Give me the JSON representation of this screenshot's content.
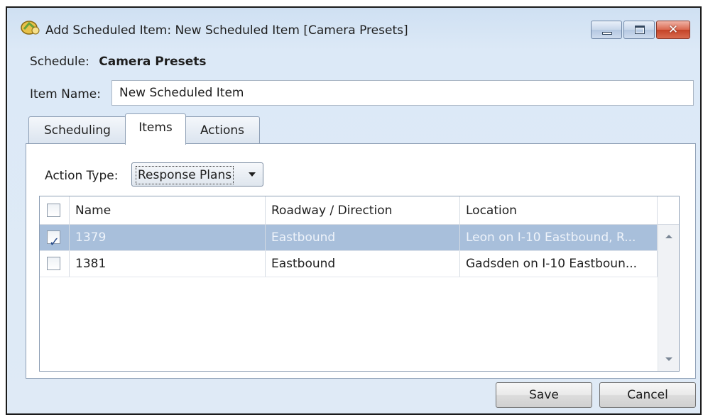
{
  "window": {
    "title": "Add Scheduled Item: New Scheduled Item [Camera Presets]",
    "icon": "scheduled-item-app-icon",
    "controls": {
      "minimize": "minimize-icon",
      "maximize": "maximize-icon",
      "close_glyph": "✕"
    }
  },
  "schedule": {
    "label": "Schedule:",
    "value": "Camera Presets"
  },
  "item_name": {
    "label": "Item Name:",
    "value": "New Scheduled Item"
  },
  "tabs": [
    {
      "label": "Scheduling",
      "active": false
    },
    {
      "label": "Items",
      "active": true
    },
    {
      "label": "Actions",
      "active": false
    }
  ],
  "action_type": {
    "label": "Action Type:",
    "selected": "Response Plans"
  },
  "grid": {
    "columns": [
      "Name",
      "Roadway / Direction",
      "Location"
    ],
    "rows": [
      {
        "checked": true,
        "selected": true,
        "name": "1379",
        "roadway": "Eastbound",
        "location": "Leon on I-10 Eastbound, R..."
      },
      {
        "checked": false,
        "selected": false,
        "name": "1381",
        "roadway": "Eastbound",
        "location": "Gadsden on I-10 Eastboun..."
      }
    ],
    "check_glyph": "✓"
  },
  "buttons": {
    "save": "Save",
    "cancel": "Cancel"
  },
  "colors": {
    "selection": "#a8bfdb",
    "window_chrome": "#cfe0f2",
    "close_button": "#c44327"
  }
}
